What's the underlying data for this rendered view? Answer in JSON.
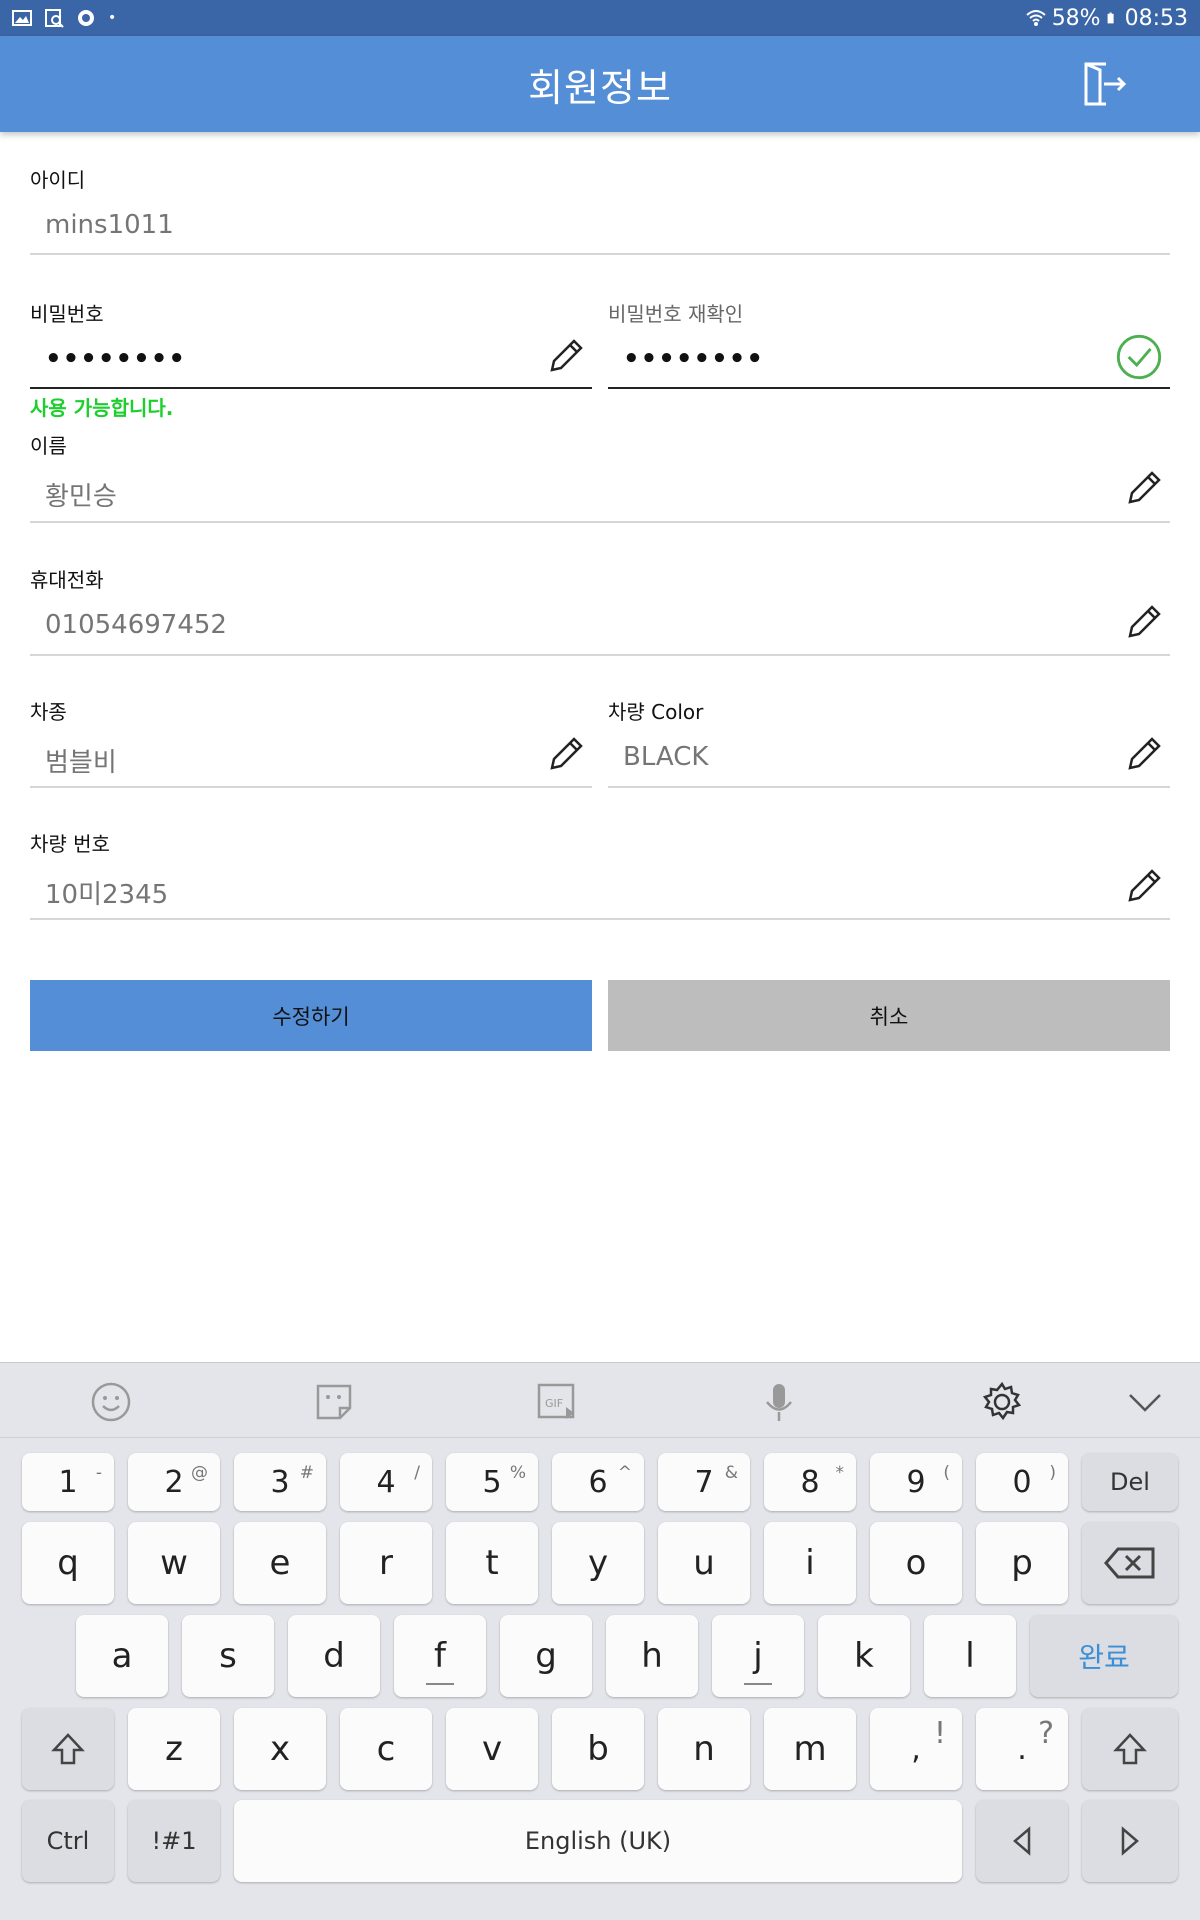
{
  "status_bar": {
    "battery": "58%",
    "time": "08:53"
  },
  "app_bar": {
    "title": "회원정보"
  },
  "form": {
    "id": {
      "label": "아이디",
      "value": "mins1011"
    },
    "password": {
      "label": "비밀번호",
      "value": "••••••••"
    },
    "password_confirm": {
      "label": "비밀번호 재확인",
      "value": "••••••••"
    },
    "password_status": "사용 가능합니다.",
    "name": {
      "label": "이름",
      "value": "황민승"
    },
    "phone": {
      "label": "휴대전화",
      "value": "01054697452"
    },
    "car_model": {
      "label": "차종",
      "value": "범블비"
    },
    "car_color": {
      "label": "차량 Color",
      "value": "BLACK"
    },
    "car_number": {
      "label": "차량 번호",
      "value": "10미2345"
    }
  },
  "buttons": {
    "submit": "수정하기",
    "cancel": "취소"
  },
  "keyboard": {
    "number_row": [
      {
        "k": "1",
        "s": "-"
      },
      {
        "k": "2",
        "s": "@"
      },
      {
        "k": "3",
        "s": "#"
      },
      {
        "k": "4",
        "s": "/"
      },
      {
        "k": "5",
        "s": "%"
      },
      {
        "k": "6",
        "s": "^"
      },
      {
        "k": "7",
        "s": "&"
      },
      {
        "k": "8",
        "s": "*"
      },
      {
        "k": "9",
        "s": "("
      },
      {
        "k": "0",
        "s": ")"
      }
    ],
    "del_label": "Del",
    "row_q": [
      "q",
      "w",
      "e",
      "r",
      "t",
      "y",
      "u",
      "i",
      "o",
      "p"
    ],
    "row_a": [
      "a",
      "s",
      "d",
      "f",
      "g",
      "h",
      "j",
      "k",
      "l"
    ],
    "done_label": "완료",
    "row_z": [
      "z",
      "x",
      "c",
      "v",
      "b",
      "n",
      "m"
    ],
    "comma_key": {
      "k": ",",
      "s": "!"
    },
    "period_key": {
      "k": ".",
      "s": "?"
    },
    "ctrl_label": "Ctrl",
    "symbols_label": "!#1",
    "space_label": "English (UK)"
  }
}
